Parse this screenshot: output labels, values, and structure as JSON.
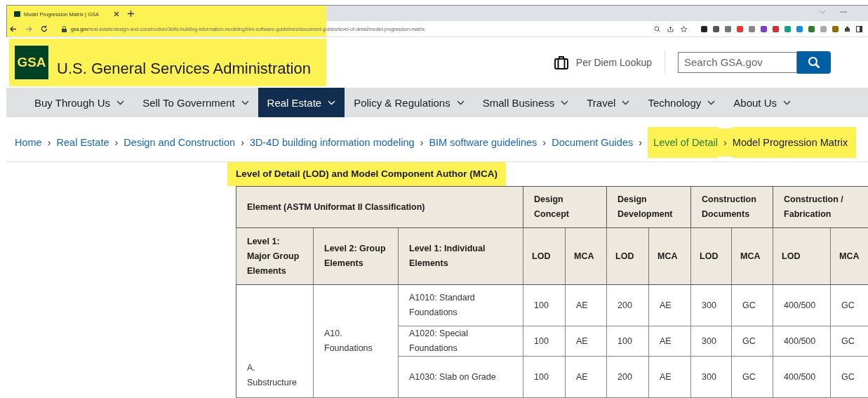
{
  "browser": {
    "tab_title": "Model Progression Matrix | GSA",
    "url_host": "gsa.gov",
    "url_path": "/real-estate/design-and-construction/3d4d-building-information-modeling/bim-software-guidelines/document-guides/level-of-detail/model-progression-matrix",
    "highlighted": true
  },
  "header": {
    "logo": "GSA",
    "title": "U.S. General Services Administration",
    "highlighted": true,
    "per_diem": "Per Diem Lookup",
    "search": {
      "placeholder": "Search GSA.gov"
    }
  },
  "nav": [
    {
      "label": "Buy Through Us",
      "selected": false
    },
    {
      "label": "Sell To Government",
      "selected": false
    },
    {
      "label": "Real Estate",
      "selected": true
    },
    {
      "label": "Policy & Regulations",
      "selected": false
    },
    {
      "label": "Small Business",
      "selected": false
    },
    {
      "label": "Travel",
      "selected": false
    },
    {
      "label": "Technology",
      "selected": false
    },
    {
      "label": "About Us",
      "selected": false
    }
  ],
  "breadcrumb": [
    {
      "label": "Home",
      "kind": "link",
      "highlighted": false
    },
    {
      "separator": "›",
      "label": "Real Estate",
      "kind": "link",
      "highlighted": false
    },
    {
      "separator": "›",
      "label": "Design and Construction",
      "kind": "link",
      "highlighted": false
    },
    {
      "separator": "›",
      "label": "3D-4D building information modeling",
      "kind": "link",
      "highlighted": false
    },
    {
      "separator": "›",
      "label": "BIM software guidelines",
      "kind": "link",
      "highlighted": false
    },
    {
      "separator": "›",
      "label": "Document Guides",
      "kind": "link",
      "highlighted": false
    },
    {
      "separator": "›",
      "label": "Level of Detail",
      "kind": "link",
      "highlighted": true
    },
    {
      "separator": "›",
      "label": "Model Progression Matrix",
      "kind": "current",
      "highlighted": true
    }
  ],
  "table_title": {
    "text": "Level of Detail (LOD) and Model Component Author (MCA)",
    "highlighted": true
  },
  "table": {
    "element_header": "Element (ASTM Uniformat II Classification)",
    "phases": [
      {
        "label": "Design Concept",
        "sub_headers": [
          "LOD",
          "MCA"
        ]
      },
      {
        "label": "Design Development",
        "sub_headers": [
          "LOD",
          "MCA"
        ]
      },
      {
        "label": "Construction Documents",
        "sub_headers": [
          "LOD",
          "MCA"
        ]
      },
      {
        "label": "Construction / Fabrication",
        "sub_headers": [
          "LOD",
          "MCA"
        ]
      }
    ],
    "level_headers": [
      "Level 1: Major Group Elements",
      "Level 2: Group Elements",
      "Level 1: Individual Elements"
    ],
    "groups": [
      {
        "label": "A. Substructure",
        "subgroups": [
          {
            "label": "A10. Foundations",
            "elements": [
              {
                "name": "A1010: Standard Foundations",
                "values": [
                  "100",
                  "AE",
                  "200",
                  "AE",
                  "300",
                  "GC",
                  "400/500",
                  "GC"
                ]
              },
              {
                "name": "A1020: Special Foundations",
                "values": [
                  "100",
                  "AE",
                  "100",
                  "AE",
                  "300",
                  "GC",
                  "400/500",
                  "GC"
                ]
              },
              {
                "name": "A1030: Slab on Grade",
                "values": [
                  "100",
                  "AE",
                  "200",
                  "AE",
                  "300",
                  "GC",
                  "400/500",
                  "GC"
                ]
              }
            ]
          }
        ]
      }
    ]
  }
}
